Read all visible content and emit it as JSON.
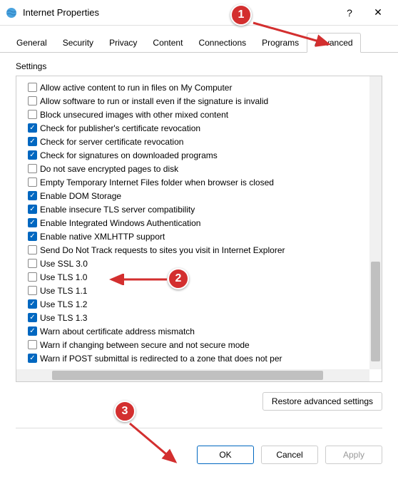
{
  "window": {
    "title": "Internet Properties",
    "help": "?",
    "close": "✕"
  },
  "tabs": [
    {
      "label": "General"
    },
    {
      "label": "Security"
    },
    {
      "label": "Privacy"
    },
    {
      "label": "Content"
    },
    {
      "label": "Connections"
    },
    {
      "label": "Programs"
    },
    {
      "label": "Advanced"
    }
  ],
  "active_tab": 6,
  "group_label": "Settings",
  "settings": [
    {
      "label": "Allow active content to run in files on My Computer",
      "checked": false
    },
    {
      "label": "Allow software to run or install even if the signature is invalid",
      "checked": false
    },
    {
      "label": "Block unsecured images with other mixed content",
      "checked": false
    },
    {
      "label": "Check for publisher's certificate revocation",
      "checked": true
    },
    {
      "label": "Check for server certificate revocation",
      "checked": true
    },
    {
      "label": "Check for signatures on downloaded programs",
      "checked": true
    },
    {
      "label": "Do not save encrypted pages to disk",
      "checked": false
    },
    {
      "label": "Empty Temporary Internet Files folder when browser is closed",
      "checked": false
    },
    {
      "label": "Enable DOM Storage",
      "checked": true
    },
    {
      "label": "Enable insecure TLS server compatibility",
      "checked": true
    },
    {
      "label": "Enable Integrated Windows Authentication",
      "checked": true
    },
    {
      "label": "Enable native XMLHTTP support",
      "checked": true
    },
    {
      "label": "Send Do Not Track requests to sites you visit in Internet Explorer",
      "checked": false
    },
    {
      "label": "Use SSL 3.0",
      "checked": false
    },
    {
      "label": "Use TLS 1.0",
      "checked": false
    },
    {
      "label": "Use TLS 1.1",
      "checked": false
    },
    {
      "label": "Use TLS 1.2",
      "checked": true
    },
    {
      "label": "Use TLS 1.3",
      "checked": true
    },
    {
      "label": "Warn about certificate address mismatch",
      "checked": true
    },
    {
      "label": "Warn if changing between secure and not secure mode",
      "checked": false
    },
    {
      "label": "Warn if POST submittal is redirected to a zone that does not per",
      "checked": true
    }
  ],
  "restore_button": "Restore advanced settings",
  "footer": {
    "ok": "OK",
    "cancel": "Cancel",
    "apply": "Apply"
  },
  "annotations": {
    "badge1": "1",
    "badge2": "2",
    "badge3": "3"
  }
}
